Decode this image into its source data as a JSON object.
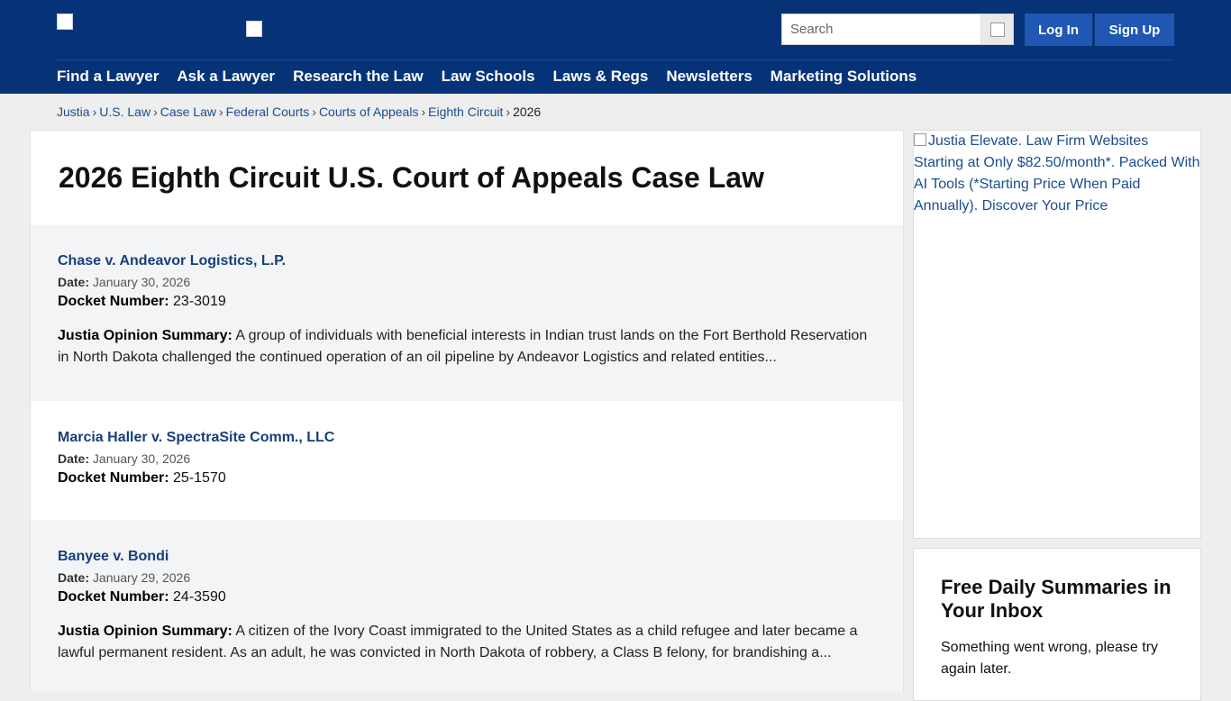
{
  "header": {
    "search_placeholder": "Search",
    "login_label": "Log In",
    "signup_label": "Sign Up",
    "nav": [
      "Find a Lawyer",
      "Ask a Lawyer",
      "Research the Law",
      "Law Schools",
      "Laws & Regs",
      "Newsletters",
      "Marketing Solutions"
    ]
  },
  "breadcrumb": {
    "items": [
      "Justia",
      "U.S. Law",
      "Case Law",
      "Federal Courts",
      "Courts of Appeals",
      "Eighth Circuit"
    ],
    "current": "2026",
    "separator": "›"
  },
  "main": {
    "title": "2026 Eighth Circuit U.S. Court of Appeals Case Law",
    "date_label": "Date:",
    "docket_label": "Docket Number:",
    "summary_label": "Justia Opinion Summary:",
    "cases": [
      {
        "title": "Chase v. Andeavor Logistics, L.P.",
        "date": "January 30, 2026",
        "docket": "23-3019",
        "summary": "A group of individuals with beneficial interests in Indian trust lands on the Fort Berthold Reservation in North Dakota challenged the continued operation of an oil pipeline by Andeavor Logistics and related entities..."
      },
      {
        "title": "Marcia Haller v. SpectraSite Comm., LLC",
        "date": "January 30, 2026",
        "docket": "25-1570",
        "summary": ""
      },
      {
        "title": "Banyee v. Bondi",
        "date": "January 29, 2026",
        "docket": "24-3590",
        "summary": "A citizen of the Ivory Coast immigrated to the United States as a child refugee and later became a lawful permanent resident. As an adult, he was convicted in North Dakota of robbery, a Class B felony, for brandishing a..."
      }
    ]
  },
  "sidebar": {
    "ad_alt": "Justia Elevate. Law Firm Websites Starting at Only $82.50/month*. Packed With AI Tools (*Starting Price When Paid Annually). Discover Your Price",
    "signup_title": "Free Daily Summaries in Your Inbox",
    "signup_message": "Something went wrong, please try again later."
  },
  "colors": {
    "header_bg": "#063378",
    "button_bg": "#1f57b3",
    "link": "#163f7a",
    "page_bg": "#eeeeee"
  }
}
